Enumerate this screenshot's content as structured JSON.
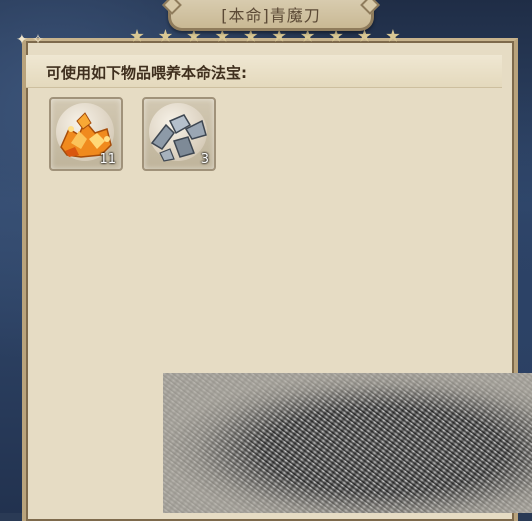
{
  "window": {
    "title": "[本命]青魔刀"
  },
  "main": {
    "prompt": "可使用如下物品喂养本命法宝:",
    "items": [
      {
        "name": "orange-crystal-shards",
        "icon": "orange-crystal-icon",
        "count": "11"
      },
      {
        "name": "gray-stone-shards",
        "icon": "gray-stone-icon",
        "count": "3"
      }
    ]
  },
  "colors": {
    "panel_bg": "#e6dcc4",
    "border": "#b9a37c",
    "text": "#3f2f1e"
  }
}
